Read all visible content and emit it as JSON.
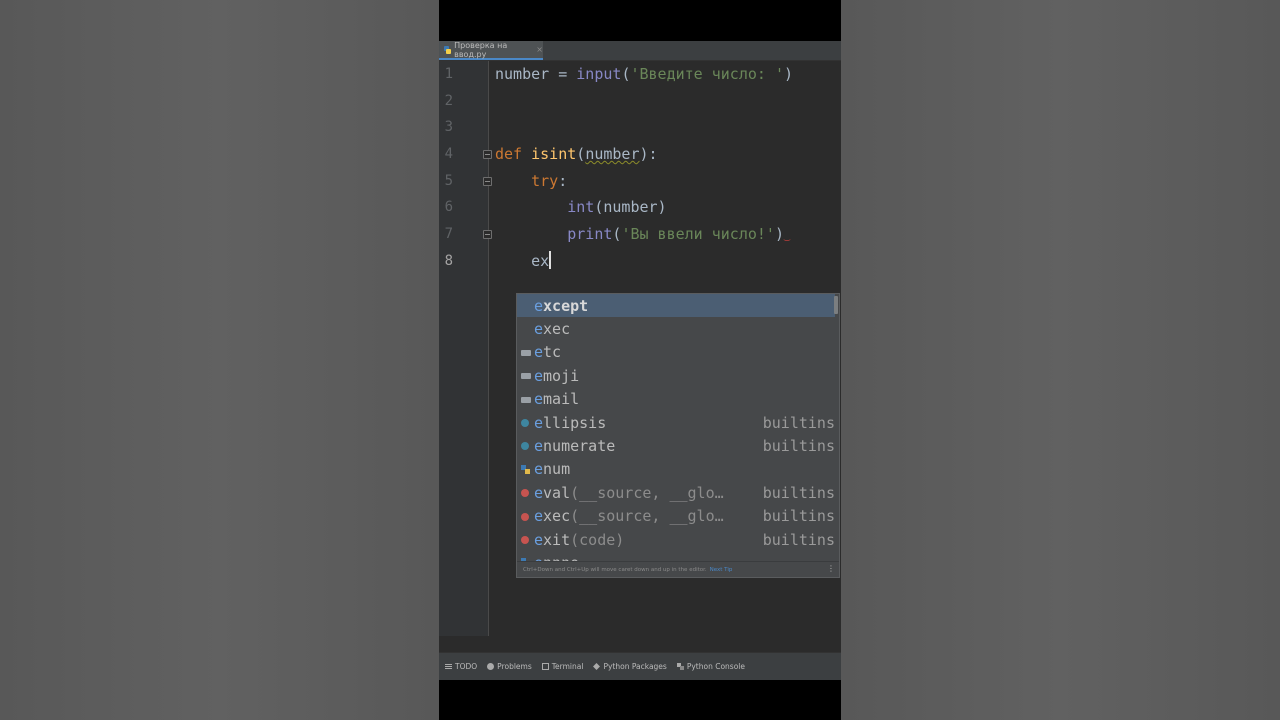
{
  "tab": {
    "filename": "Проверка на ввод.py",
    "close": "×"
  },
  "gutter": {
    "line_numbers": [
      "1",
      "2",
      "3",
      "4",
      "5",
      "6",
      "7",
      "8"
    ]
  },
  "code": {
    "line1": {
      "var": "number",
      "op": " = ",
      "fn": "input",
      "open": "(",
      "str": "'Введите число: '",
      "close": ")"
    },
    "line4": {
      "kw": "def",
      "name": "isint",
      "open": "(",
      "param": "number",
      "close": "):"
    },
    "line5": {
      "kw": "try",
      "colon": ":"
    },
    "line6": {
      "fn": "int",
      "args": "(number)"
    },
    "line7": {
      "fn": "print",
      "open": "(",
      "str": "'Вы ввели число!'",
      "close": ")"
    },
    "line8": {
      "typed": "ex"
    }
  },
  "completion": {
    "items": [
      {
        "prefix": "e",
        "rest": "xcept",
        "params": "",
        "type": "",
        "icon": "none"
      },
      {
        "prefix": "e",
        "rest": "xec",
        "params": "",
        "type": "",
        "icon": "none"
      },
      {
        "prefix": "e",
        "rest": "tc",
        "params": "",
        "type": "",
        "icon": "folder-icon"
      },
      {
        "prefix": "e",
        "rest": "moji",
        "params": "",
        "type": "",
        "icon": "folder-icon"
      },
      {
        "prefix": "e",
        "rest": "mail",
        "params": "",
        "type": "",
        "icon": "folder-icon"
      },
      {
        "prefix": "e",
        "rest": "llipsis",
        "params": "",
        "type": "builtins",
        "icon": "class-icon"
      },
      {
        "prefix": "e",
        "rest": "numerate",
        "params": "",
        "type": "builtins",
        "icon": "class-icon"
      },
      {
        "prefix": "e",
        "rest": "num",
        "params": "",
        "type": "",
        "icon": "python-module-icon"
      },
      {
        "prefix": "e",
        "rest": "val",
        "params": "(__source, __glo…",
        "type": "builtins",
        "icon": "function-icon"
      },
      {
        "prefix": "e",
        "rest": "xec",
        "params": "(__source, __glo…",
        "type": "builtins",
        "icon": "function-icon"
      },
      {
        "prefix": "e",
        "rest": "xit",
        "params": "(code)",
        "type": "builtins",
        "icon": "function-icon"
      },
      {
        "prefix": "e",
        "rest": "nnno",
        "params": "",
        "type": "",
        "icon": "python-module-icon"
      }
    ],
    "footer_hint": "Ctrl+Down and Ctrl+Up will move caret down and up in the editor.",
    "footer_tip": "Next Tip"
  },
  "toolwindows": [
    "TODO",
    "Problems",
    "Terminal",
    "Python Packages",
    "Python Console"
  ]
}
